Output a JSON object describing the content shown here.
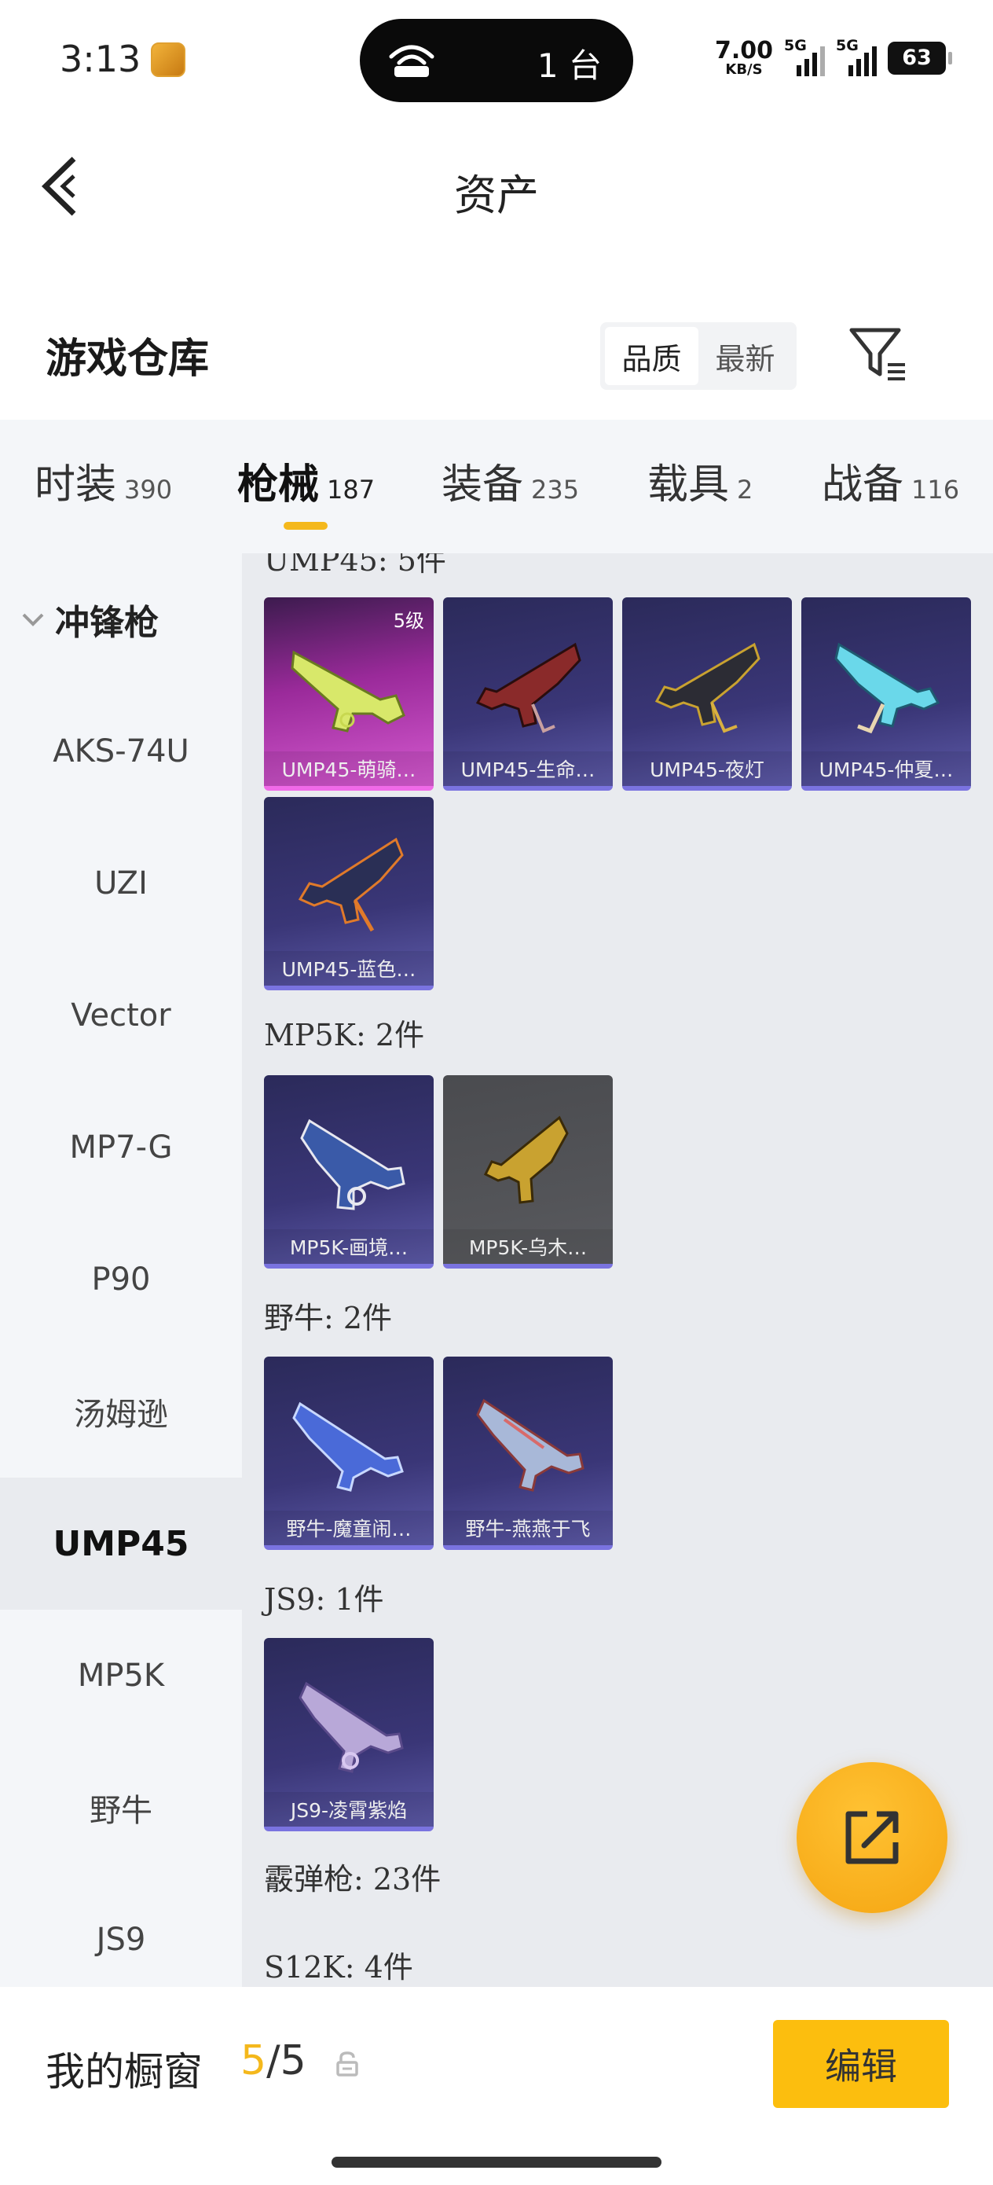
{
  "status_bar": {
    "time": "3:13",
    "hotspot_count": "1 台",
    "net_speed": "7.00",
    "net_speed_unit": "KB/S",
    "sim1": "5G",
    "sim2": "5G",
    "battery": "63"
  },
  "header": {
    "title": "资产",
    "back_icon": "chevron-left-icon"
  },
  "section": {
    "title": "游戏仓库",
    "sort_options": [
      "品质",
      "最新"
    ],
    "sort_active": "品质",
    "filter_icon": "filter-icon"
  },
  "category_tabs": [
    {
      "label": "时装",
      "count": "390"
    },
    {
      "label": "枪械",
      "count": "187",
      "active": true
    },
    {
      "label": "装备",
      "count": "235"
    },
    {
      "label": "载具",
      "count": "2"
    },
    {
      "label": "战备",
      "count": "116"
    }
  ],
  "side_menu": {
    "group": "冲锋枪",
    "items": [
      "AKS-74U",
      "UZI",
      "Vector",
      "MP7-G",
      "P90",
      "汤姆逊",
      "UMP45",
      "MP5K",
      "野牛",
      "JS9"
    ],
    "active": "UMP45"
  },
  "groups": [
    {
      "heading": "UMP45: 5件",
      "items": [
        {
          "name": "UMP45-萌骑…",
          "level": "5级",
          "rarity": "legendary"
        },
        {
          "name": "UMP45-生命…",
          "rarity": "epic"
        },
        {
          "name": "UMP45-夜灯",
          "rarity": "epic"
        },
        {
          "name": "UMP45-仲夏…",
          "rarity": "epic"
        },
        {
          "name": "UMP45-蓝色…",
          "rarity": "epic"
        }
      ]
    },
    {
      "heading": "MP5K: 2件",
      "items": [
        {
          "name": "MP5K-画境…",
          "rarity": "epic"
        },
        {
          "name": "MP5K-乌木…",
          "rarity": "rare"
        }
      ]
    },
    {
      "heading": "野牛: 2件",
      "items": [
        {
          "name": "野牛-魔童闹…",
          "rarity": "epic"
        },
        {
          "name": "野牛-燕燕于飞",
          "rarity": "epic"
        }
      ]
    },
    {
      "heading": "JS9: 1件",
      "items": [
        {
          "name": "JS9-凌霄紫焰",
          "rarity": "epic"
        }
      ]
    },
    {
      "heading": "霰弹枪: 23件",
      "items": []
    },
    {
      "heading": "S12K: 4件",
      "items": []
    }
  ],
  "share_button_icon": "share-external-icon",
  "bottom_bar": {
    "label": "我的橱窗",
    "current": "5",
    "separator": "/",
    "total": "5",
    "lock_icon": "lock-icon",
    "edit_label": "编辑"
  },
  "colors": {
    "accent": "#f4b81c",
    "edit_button": "#fcbe0e",
    "legendary_card": "#d55ad0",
    "epic_card": "#3a3677",
    "rare_card": "#545559"
  }
}
